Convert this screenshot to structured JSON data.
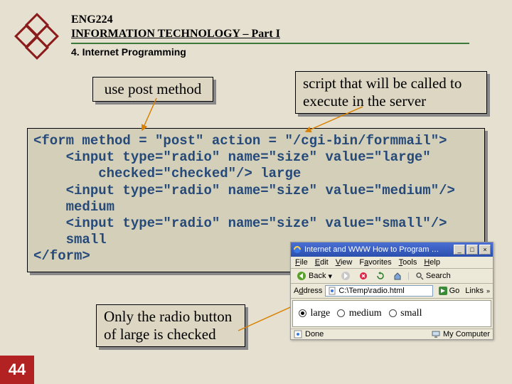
{
  "header": {
    "course": "ENG224",
    "title": "INFORMATION TECHNOLOGY – Part I",
    "section": "4. Internet Programming"
  },
  "callouts": {
    "usePost": "use post method",
    "scriptNote": "script that will be called to execute in the server",
    "radioNote": "Only the radio button of large is checked"
  },
  "code": "<form method = \"post\" action = \"/cgi-bin/formmail\">\n    <input type=\"radio\" name=\"size\" value=\"large\"\n        checked=\"checked\"/> large\n    <input type=\"radio\" name=\"size\" value=\"medium\"/>\n    medium\n    <input type=\"radio\" name=\"size\" value=\"small\"/>\n    small\n</form>",
  "page": "44",
  "browser": {
    "title": "Internet and WWW How to Program …",
    "menu": {
      "file": "File",
      "edit": "Edit",
      "view": "View",
      "fav": "Favorites",
      "tools": "Tools",
      "help": "Help"
    },
    "toolbar": {
      "back": "Back",
      "search": "Search"
    },
    "address": {
      "label": "Address",
      "path": "C:\\Temp\\radio.html",
      "go": "Go",
      "links": "Links"
    },
    "options": {
      "large": "large",
      "medium": "medium",
      "small": "small"
    },
    "status": {
      "done": "Done",
      "zone": "My Computer"
    }
  }
}
